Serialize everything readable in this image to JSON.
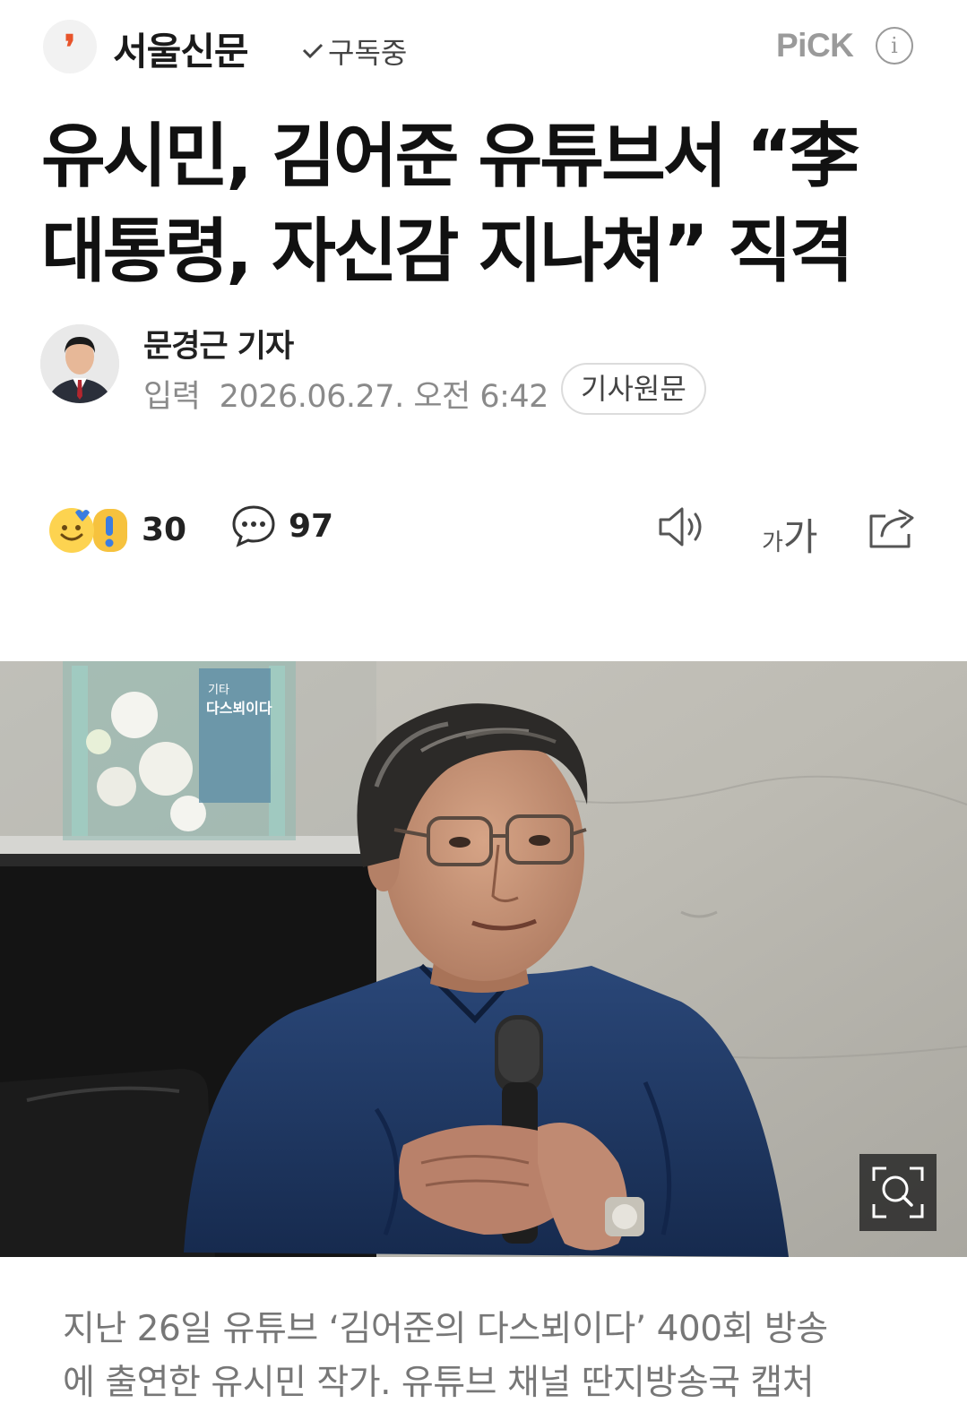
{
  "header": {
    "press_logo_glyph": "❜",
    "press_name": "서울신문",
    "subscribe_label": "구독중",
    "pick_label": "PiCK",
    "info_glyph": "i"
  },
  "article": {
    "headline_line1": "유시민, 김어준 유튜브서 “李",
    "headline_line2": "대통령, 자신감 지나쳐” 직격",
    "reporter": "문경근 기자",
    "input_label": "입력",
    "datetime": "2026.06.27. 오전 6:42",
    "original_button": "기사원문"
  },
  "toolbar": {
    "reaction_count": "30",
    "comment_count": "97",
    "font_small": "가",
    "font_large": "가"
  },
  "photo": {
    "sign_text_top": "기타",
    "sign_text_main": "다스뵈이다"
  },
  "caption": {
    "line1": "지난 26일 유튜브 ‘김어준의 다스뵈이다’ 400회 방송",
    "line2": "에 출연한 유시민 작가. 유튜브 채널 딴지방송국 캡처"
  },
  "colors": {
    "logo_accent": "#e8542b",
    "pick_gray": "#9a9a9a",
    "caption_gray": "#777777",
    "shirt_navy": "#1f3560"
  },
  "icons": {
    "reaction": "emoji-reaction-icon",
    "comment": "speech-bubble-icon",
    "audio": "speaker-icon",
    "font": "font-size-icon",
    "share": "share-icon",
    "zoom": "zoom-icon"
  }
}
